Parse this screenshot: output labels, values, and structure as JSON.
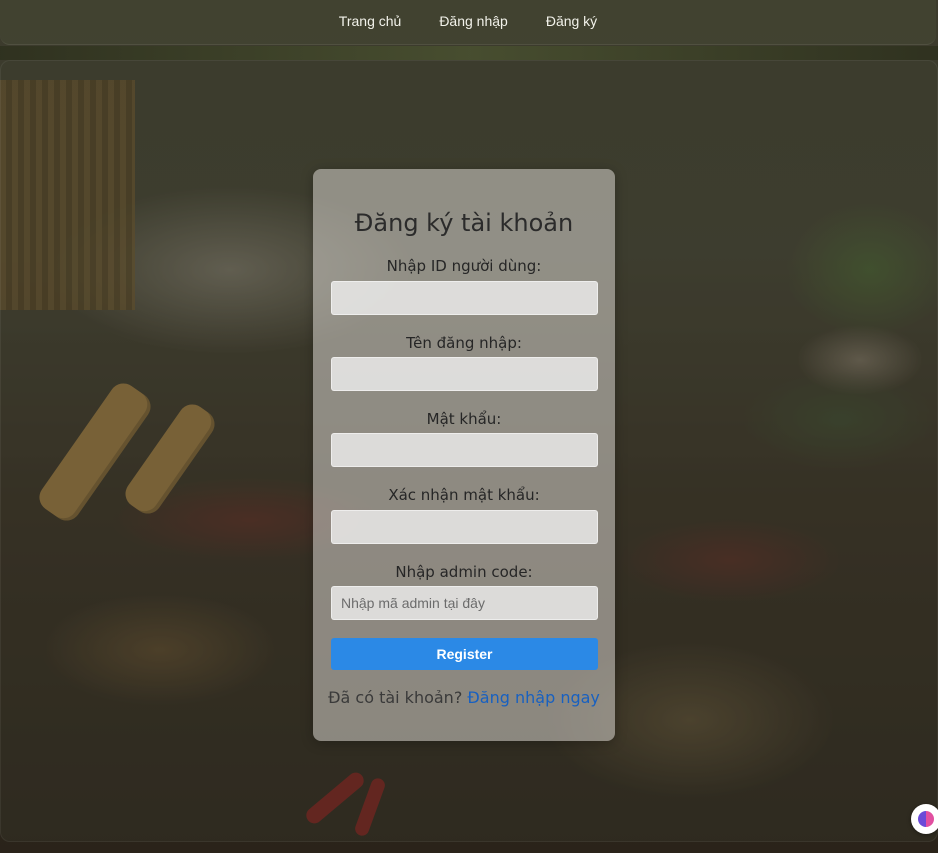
{
  "nav": {
    "items": [
      "Trang chủ",
      "Đăng nhập",
      "Đăng ký"
    ]
  },
  "form": {
    "title": "Đăng ký tài khoản",
    "fields": [
      {
        "label": "Nhập ID người dùng:",
        "value": "",
        "placeholder": ""
      },
      {
        "label": "Tên đăng nhập:",
        "value": "",
        "placeholder": ""
      },
      {
        "label": "Mật khẩu:",
        "value": "",
        "placeholder": ""
      },
      {
        "label": "Xác nhận mật khẩu:",
        "value": "",
        "placeholder": ""
      },
      {
        "label": "Nhập admin code:",
        "value": "",
        "placeholder": "Nhập mã admin tại đây"
      }
    ],
    "submit_label": "Register",
    "footer_text": "Đã có tài khoản?",
    "footer_link": "Đăng nhập ngay"
  },
  "colors": {
    "button": "#2b89e6",
    "link": "#1860c0"
  },
  "icons": {
    "floating_button": "brain-icon"
  }
}
